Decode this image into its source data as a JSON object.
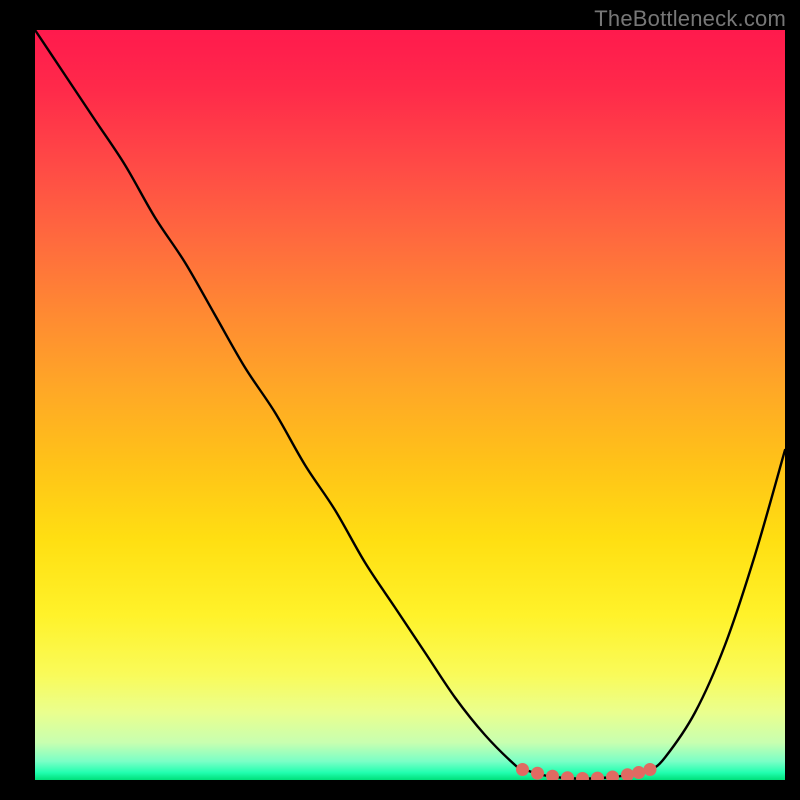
{
  "watermark": {
    "text": "TheBottleneck.com"
  },
  "colors": {
    "background": "#000000",
    "curve_stroke": "#000000",
    "marker_fill": "#e06a62",
    "marker_stroke": "#e06a62",
    "gradient_stops": [
      "#ff1a4d",
      "#ff2a4a",
      "#ff4a46",
      "#ff6a3e",
      "#ff8a32",
      "#ffa826",
      "#ffc318",
      "#ffdf12",
      "#fff22a",
      "#f9fb5a",
      "#eaff8e",
      "#c8ffb0",
      "#7bffc6",
      "#22ffb0",
      "#00e07a"
    ]
  },
  "chart_data": {
    "type": "line",
    "title": "",
    "xlabel": "",
    "ylabel": "",
    "xlim": [
      0,
      100
    ],
    "ylim": [
      0,
      100
    ],
    "grid": false,
    "legend": false,
    "series": [
      {
        "name": "curve",
        "x": [
          0,
          4,
          8,
          12,
          16,
          20,
          24,
          28,
          32,
          36,
          40,
          44,
          48,
          52,
          56,
          60,
          64,
          65,
          68,
          72,
          76,
          80,
          82,
          84,
          88,
          92,
          96,
          100
        ],
        "y": [
          100,
          94,
          88,
          82,
          75,
          69,
          62,
          55,
          49,
          42,
          36,
          29,
          23,
          17,
          11,
          6,
          2,
          1.5,
          0.6,
          0.2,
          0.3,
          0.8,
          1.3,
          3,
          9,
          18,
          30,
          44
        ]
      }
    ],
    "markers": {
      "name": "bottom-cluster",
      "x": [
        65,
        67,
        69,
        71,
        73,
        75,
        77,
        79,
        80.5,
        82
      ],
      "y": [
        1.4,
        0.9,
        0.5,
        0.3,
        0.2,
        0.25,
        0.4,
        0.7,
        1.0,
        1.4
      ],
      "size": 12
    }
  }
}
